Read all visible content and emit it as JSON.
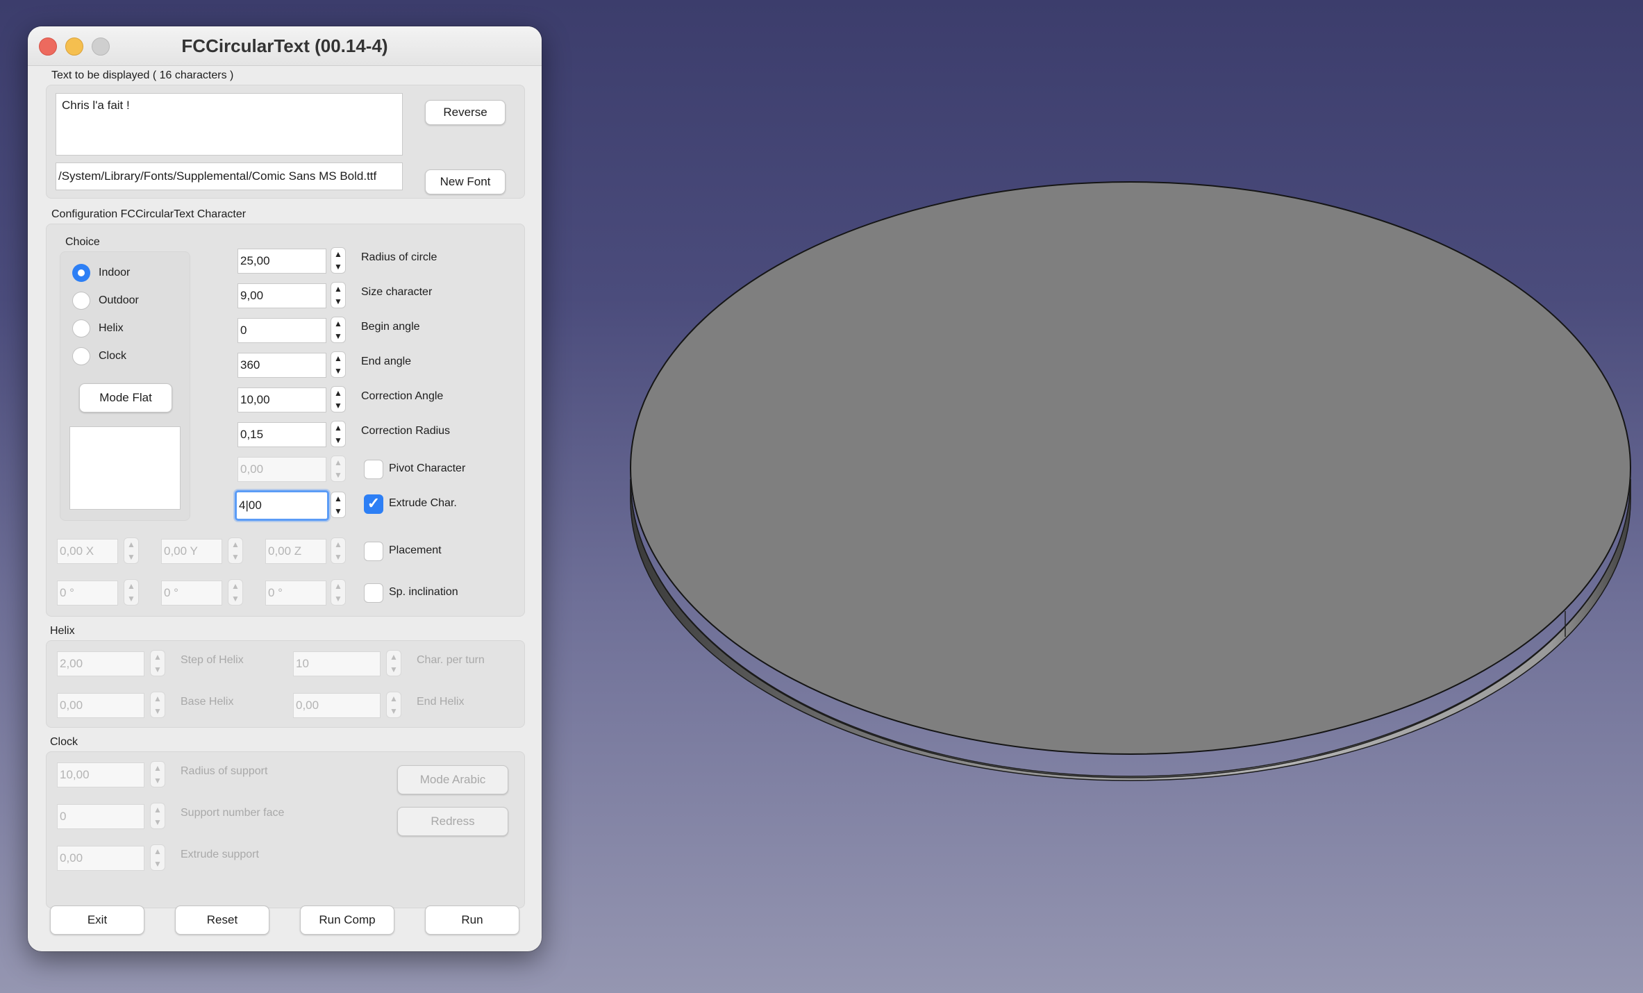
{
  "window": {
    "title": "FCCircularText (00.14-4)"
  },
  "text_group": {
    "label": "Text to be displayed  ( 16 characters )",
    "text_value": "Chris l'a fait !",
    "font_path": "/System/Library/Fonts/Supplemental/Comic Sans MS Bold.ttf",
    "reverse_label": "Reverse",
    "new_font_label": "New Font"
  },
  "config": {
    "label": "Configuration FCCircularText Character",
    "choice_label": "Choice",
    "choices": [
      "Indoor",
      "Outdoor",
      "Helix",
      "Clock"
    ],
    "selected_choice": "Indoor",
    "mode_flat_label": "Mode Flat",
    "params": [
      {
        "value": "25,00",
        "label": "Radius of circle"
      },
      {
        "value": "9,00",
        "label": "Size character"
      },
      {
        "value": "0",
        "label": "Begin angle"
      },
      {
        "value": "360",
        "label": "End angle"
      },
      {
        "value": "10,00",
        "label": "Correction Angle"
      },
      {
        "value": "0,15",
        "label": "Correction Radius"
      },
      {
        "value": "0,00",
        "label": "Pivot Character",
        "checked": false,
        "disabled": true
      },
      {
        "value": "4,00",
        "label": "Extrude Char.",
        "checked": true
      }
    ],
    "placement": {
      "x": "0,00 X",
      "y": "0,00 Y",
      "z": "0,00 Z",
      "label": "Placement",
      "checked": false
    },
    "inclination": {
      "a": "0 °",
      "b": "0 °",
      "c": "0 °",
      "label": "Sp. inclination",
      "checked": false
    }
  },
  "helix": {
    "label": "Helix",
    "step_value": "2,00",
    "step_label": "Step of Helix",
    "char_turn_value": "10",
    "char_turn_label": "Char. per turn",
    "base_value": "0,00",
    "base_label": "Base Helix",
    "end_value": "0,00",
    "end_label": "End Helix"
  },
  "clock": {
    "label": "Clock",
    "radius_value": "10,00",
    "radius_label": "Radius of support",
    "face_value": "0",
    "face_label": "Support number face",
    "extrude_value": "0,00",
    "extrude_label": "Extrude support",
    "mode_arabic_label": "Mode Arabic",
    "redress_label": "Redress"
  },
  "footer": {
    "exit_label": "Exit",
    "reset_label": "Reset",
    "run_comp_label": "Run Comp",
    "run_label": "Run"
  },
  "colors": {
    "accent": "#2d7ff5",
    "disc_top": "#7f7f7f",
    "background_top": "#3c3d6c",
    "background_bottom": "#9596b1"
  }
}
